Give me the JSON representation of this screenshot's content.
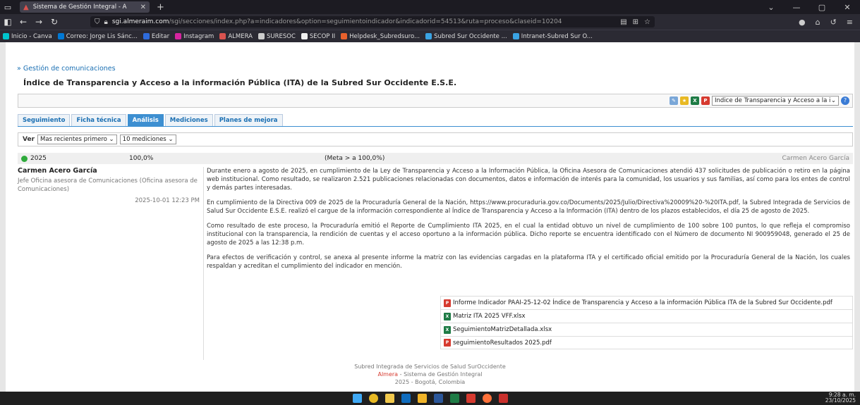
{
  "browser": {
    "tab_title": "Sistema de Gestión Integral - A",
    "tab_close": "✕",
    "new_tab": "+",
    "url_host": "sgi.almeraim.com",
    "url_path": "/sgi/secciones/index.php?a=indicadores&option=seguimientoindicador&indicadorid=54513&ruta=proceso&claseid=10204",
    "bookmarks": [
      {
        "label": "Inicio - Canva",
        "color": "#00c4cc"
      },
      {
        "label": "Correo: Jorge Lis Sánc...",
        "color": "#0078d4"
      },
      {
        "label": "Editar",
        "color": "#2e6bdb"
      },
      {
        "label": "Instagram",
        "color": "#d6249f"
      },
      {
        "label": "ALMERA",
        "color": "#d9534f"
      },
      {
        "label": "SURESOC",
        "color": "#cccccc"
      },
      {
        "label": "SECOP II",
        "color": "#f0f0f0"
      },
      {
        "label": "Helpdesk_Subredsuro...",
        "color": "#e8612c"
      },
      {
        "label": "Subred Sur Occidente ...",
        "color": "#3aa3e3"
      },
      {
        "label": "Intranet-Subred Sur O...",
        "color": "#3aa3e3"
      }
    ]
  },
  "page": {
    "breadcrumb": "» Gestión de comunicaciones",
    "title": "Índice de Transparencia y Acceso a la información Pública (ITA) de la Subred Sur Occidente E.S.E.",
    "indicator_select": "Índice de Transparencia y Acceso a la inforr",
    "help": "?",
    "tabs": [
      {
        "label": "Seguimiento",
        "active": false
      },
      {
        "label": "Ficha técnica",
        "active": false
      },
      {
        "label": "Análisis",
        "active": true
      },
      {
        "label": "Mediciones",
        "active": false
      },
      {
        "label": "Planes de mejora",
        "active": false
      }
    ],
    "filter": {
      "label": "Ver",
      "order": "Mas recientes primero",
      "count": "10 mediciones"
    },
    "measurement": {
      "year": "2025",
      "value": "100,0%",
      "goal": "(Meta > a 100,0%)",
      "author": "Carmen Acero García",
      "status_color": "#2eaa3b"
    },
    "analysis": {
      "author": "Carmen Acero García",
      "role": "Jefe Oficina asesora de Comunicaciones (Oficina asesora de Comunicaciones)",
      "date": "2025-10-01 12:23 PM",
      "paragraphs": [
        "Durante enero a agosto de 2025, en cumplimiento de la Ley de Transparencia y Acceso a la Información Pública, la Oficina Asesora de Comunicaciones atendió 437 solicitudes de publicación o retiro en la página web institucional. Como resultado, se realizaron 2.521 publicaciones relacionadas con documentos, datos e información de interés para la comunidad, los usuarios y sus familias, así como para los entes de control y demás partes interesadas.",
        "En cumplimiento de la Directiva 009 de 2025 de la Procuraduría General de la Nación, https://www.procuraduria.gov.co/Documents/2025/Julio/Directiva%20009%20-%20ITA.pdf, la Subred Integrada de Servicios de Salud Sur Occidente E.S.E. realizó el cargue de la información correspondiente al Índice de Transparencia y Acceso a la Información (ITA) dentro de los plazos establecidos, el día 25 de agosto de 2025.",
        "Como resultado de este proceso, la Procuraduría emitió el Reporte de Cumplimiento ITA 2025, en el cual la entidad obtuvo un nivel de cumplimiento de 100 sobre 100 puntos, lo que refleja el compromiso institucional con la transparencia, la rendición de cuentas y el acceso oportuno a la información pública. Dicho reporte se encuentra identificado con el Número de documento NI 900959048, generado el 25 de agosto de 2025 a las 12:38 p.m.",
        "Para efectos de verificación y control, se anexa al presente informe la matriz con las evidencias cargadas en la plataforma ITA y el certificado oficial emitido por la Procuraduría General de la Nación, los cuales respaldan y acreditan el cumplimiento del indicador en mención."
      ],
      "files": [
        {
          "name": "Informe Indicador PAAI-25-12-02 Índice de Transparencia y Acceso a la información Pública ITA de la Subred Sur Occidente.pdf",
          "type": "pdf"
        },
        {
          "name": "Matriz ITA 2025 VFF.xlsx",
          "type": "xls"
        },
        {
          "name": "SeguimientoMatrizDetallada.xlsx",
          "type": "xls"
        },
        {
          "name": "seguimientoResultados 2025.pdf",
          "type": "pdf"
        }
      ]
    },
    "footer": {
      "org": "Subred Integrada de Servicios de Salud SurOccidente",
      "brand": "Almera",
      "system": " - Sistema de Gestión Integral",
      "place": "2025 - Bogotá, Colombia"
    }
  },
  "taskbar": {
    "time": "9:28 a. m.",
    "date": "23/10/2025"
  }
}
